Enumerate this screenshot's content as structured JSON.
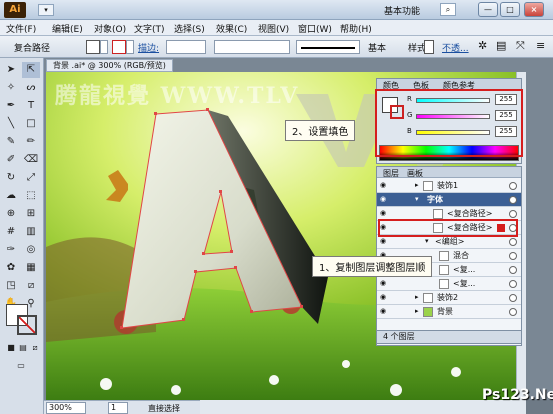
{
  "app": {
    "logo": "Ai",
    "workspace": "基本功能",
    "title_dropdown": "▾",
    "search_icon": "⌕"
  },
  "window_buttons": [
    "—",
    "□",
    "×"
  ],
  "menu": [
    "文件(F)",
    "编辑(E)",
    "对象(O)",
    "文字(T)",
    "选择(S)",
    "效果(C)",
    "视图(V)",
    "窗口(W)",
    "帮助(H)"
  ],
  "control_bar": {
    "object_type": "复合路径",
    "stroke_label": "描边:",
    "stroke_style": "基本",
    "style_label": "样式:",
    "opacity_label": "不透..."
  },
  "document": {
    "tab": "背景 .ai* @ 300% (RGB/预览)",
    "zoom": "300%",
    "page": "1",
    "status": "直接选择"
  },
  "color_panel": {
    "tabs": [
      "颜色",
      "色板",
      "颜色参考"
    ],
    "sliders": [
      {
        "label": "R",
        "value": "255"
      },
      {
        "label": "G",
        "value": "255"
      },
      {
        "label": "B",
        "value": "255"
      }
    ]
  },
  "layers_panel": {
    "tabs": [
      "图层",
      "画板"
    ],
    "rows": [
      {
        "name": "装饰1",
        "indent": 1
      },
      {
        "name": "字体",
        "indent": 1,
        "selected": true
      },
      {
        "name": "<复合路径>",
        "indent": 2
      },
      {
        "name": "<复合路径>",
        "indent": 2
      },
      {
        "name": "<编组>",
        "indent": 2
      },
      {
        "name": "混合",
        "indent": 3
      },
      {
        "name": "<复...",
        "indent": 3
      },
      {
        "name": "<复...",
        "indent": 3
      },
      {
        "name": "装饰2",
        "indent": 1
      },
      {
        "name": "背景",
        "indent": 1
      }
    ],
    "footer": "4 个图层"
  },
  "callouts": {
    "set_fill": "2、设置填色",
    "copy_layer": "1、复制图层调整图层顺"
  },
  "watermarks": {
    "logo_text": "腾龍視覺 WWW.TLV",
    "site": "Ps123.Net"
  },
  "colors": {
    "accent_red": "#d51e1e",
    "selected_layer": "#3c5f94",
    "sky_green": "#b9dd3a"
  }
}
